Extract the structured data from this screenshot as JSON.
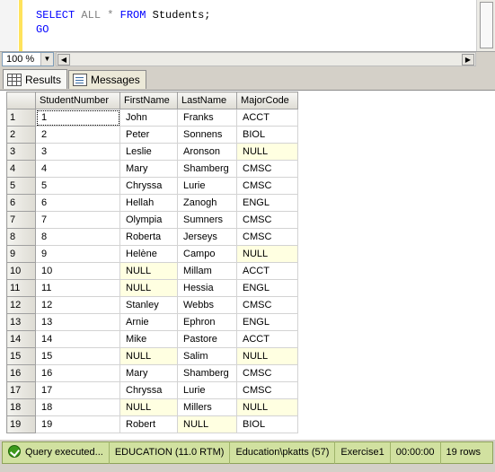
{
  "editor": {
    "line1": {
      "kw1": "SELECT",
      "all": "ALL",
      "star": "*",
      "kw2": "FROM",
      "table": "Students;"
    },
    "line2": {
      "go": "GO"
    }
  },
  "zoom": {
    "value": "100 %"
  },
  "tabs": [
    {
      "label": "Results",
      "icon": "grid-icon",
      "active": true
    },
    {
      "label": "Messages",
      "icon": "messages-icon",
      "active": false
    }
  ],
  "grid": {
    "columns": [
      "StudentNumber",
      "FirstName",
      "LastName",
      "MajorCode"
    ],
    "rows": [
      [
        "1",
        "1",
        "John",
        "Franks",
        "ACCT"
      ],
      [
        "2",
        "2",
        "Peter",
        "Sonnens",
        "BIOL"
      ],
      [
        "3",
        "3",
        "Leslie",
        "Aronson",
        "NULL"
      ],
      [
        "4",
        "4",
        "Mary",
        "Shamberg",
        "CMSC"
      ],
      [
        "5",
        "5",
        "Chryssa",
        "Lurie",
        "CMSC"
      ],
      [
        "6",
        "6",
        "Hellah",
        "Zanogh",
        "ENGL"
      ],
      [
        "7",
        "7",
        "Olympia",
        "Sumners",
        "CMSC"
      ],
      [
        "8",
        "8",
        "Roberta",
        "Jerseys",
        "CMSC"
      ],
      [
        "9",
        "9",
        "Helène",
        "Campo",
        "NULL"
      ],
      [
        "10",
        "10",
        "NULL",
        "Millam",
        "ACCT"
      ],
      [
        "11",
        "11",
        "NULL",
        "Hessia",
        "ENGL"
      ],
      [
        "12",
        "12",
        "Stanley",
        "Webbs",
        "CMSC"
      ],
      [
        "13",
        "13",
        "Arnie",
        "Ephron",
        "ENGL"
      ],
      [
        "14",
        "14",
        "Mike",
        "Pastore",
        "ACCT"
      ],
      [
        "15",
        "15",
        "NULL",
        "Salim",
        "NULL"
      ],
      [
        "16",
        "16",
        "Mary",
        "Shamberg",
        "CMSC"
      ],
      [
        "17",
        "17",
        "Chryssa",
        "Lurie",
        "CMSC"
      ],
      [
        "18",
        "18",
        "NULL",
        "Millers",
        "NULL"
      ],
      [
        "19",
        "19",
        "Robert",
        "NULL",
        "BIOL"
      ]
    ]
  },
  "status": {
    "message": "Query executed...",
    "server": "EDUCATION (11.0 RTM)",
    "user": "Education\\pkatts (57)",
    "database": "Exercise1",
    "elapsed": "00:00:00",
    "rows": "19 rows"
  },
  "colors": {
    "null_cell": "#ffffe1",
    "status_bar": "#d1e1a0",
    "keyword": "#0000ff"
  }
}
